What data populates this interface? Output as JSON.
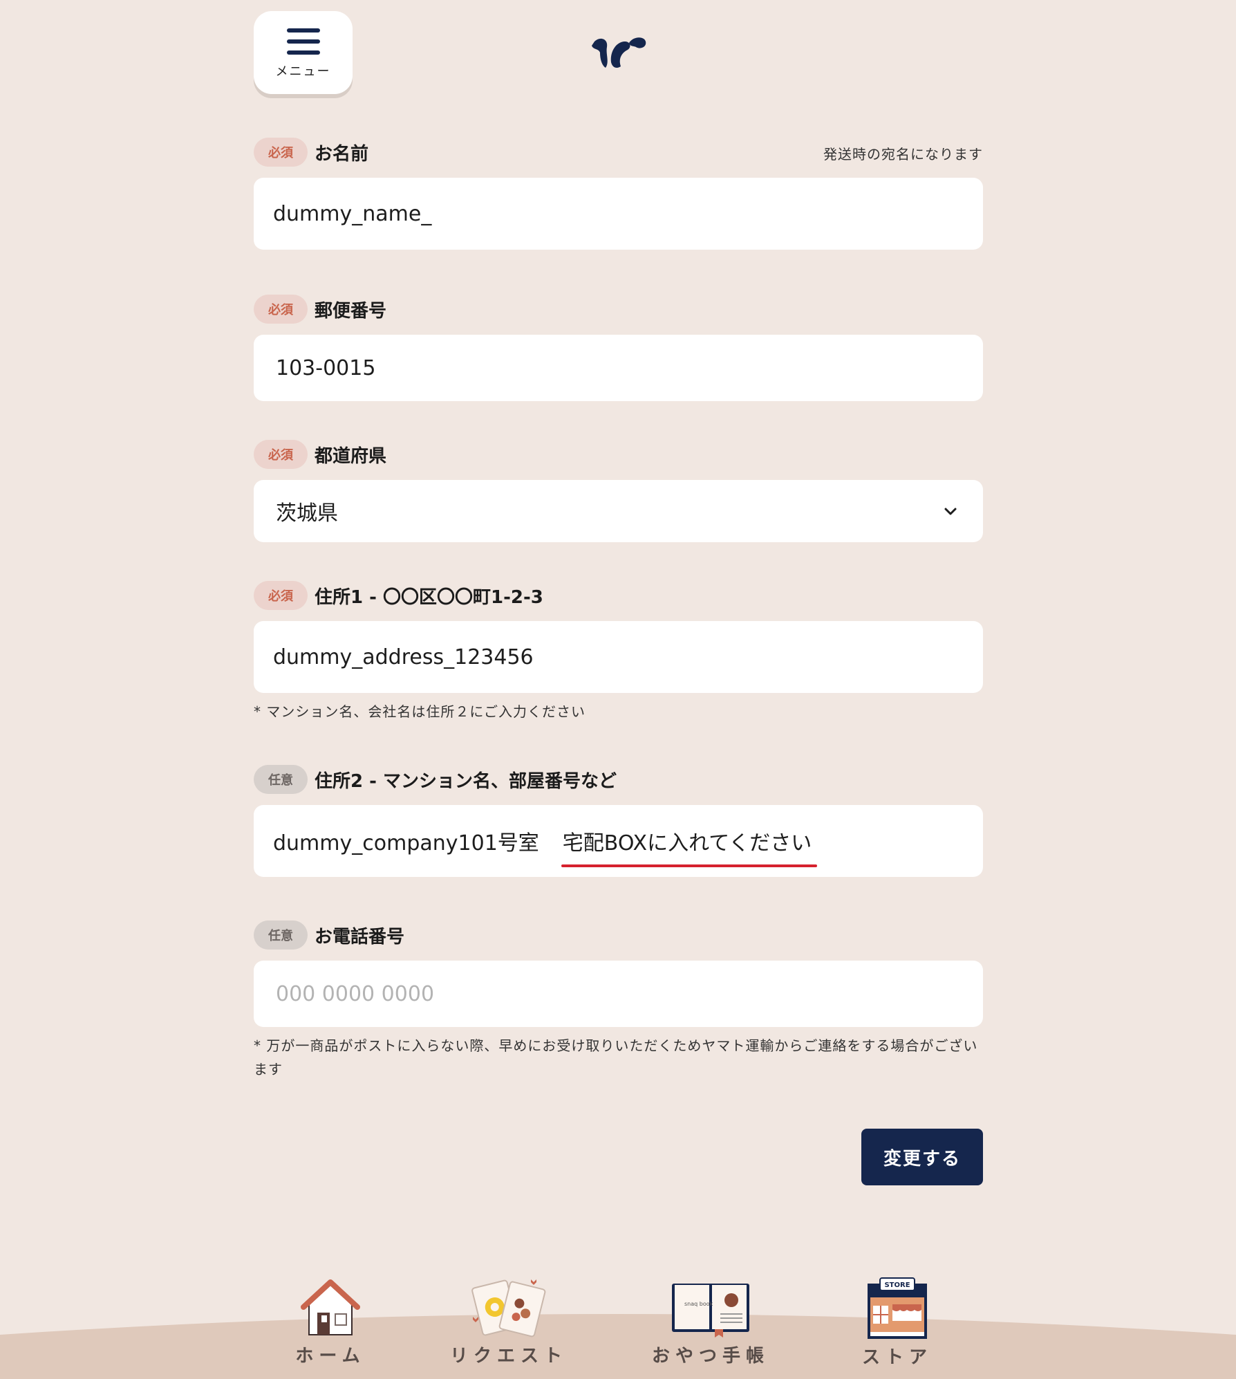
{
  "header": {
    "menu_label": "メニュー"
  },
  "form": {
    "name": {
      "badge": "必須",
      "label": "お名前",
      "hint": "発送時の宛名になります",
      "value": "dummy_name_"
    },
    "postal": {
      "badge": "必須",
      "label": "郵便番号",
      "value": "103-0015"
    },
    "prefecture": {
      "badge": "必須",
      "label": "都道府県",
      "value": "茨城県"
    },
    "address1": {
      "badge": "必須",
      "label": "住所1 - 〇〇区〇〇町1-2-3",
      "value": "dummy_address_123456",
      "note": "* マンション名、会社名は住所２にご入力ください"
    },
    "address2": {
      "badge": "任意",
      "label": "住所2 - マンション名、部屋番号など",
      "value": "dummy_company101号室",
      "value_extra": "宅配BOXに入れてください"
    },
    "phone": {
      "badge": "任意",
      "label": "お電話番号",
      "placeholder": "000 0000 0000",
      "note": "* 万が一商品がポストに入らない際、早めにお受け取りいただくためヤマト運輸からご連絡をする場合がございます"
    },
    "submit_label": "変更する"
  },
  "bottom_nav": {
    "items": [
      {
        "label": "ホーム",
        "icon": "house-icon"
      },
      {
        "label": "リクエスト",
        "icon": "snack-cards-icon"
      },
      {
        "label": "おやつ手帳",
        "icon": "snaq-book-icon"
      },
      {
        "label": "ストア",
        "icon": "store-icon"
      }
    ],
    "store_sign": "STORE",
    "book_text": "snaq book"
  },
  "colors": {
    "background": "#f1e7e1",
    "navy": "#15264d",
    "required_badge": "#ecd3cd",
    "optional_badge": "#d7d0cc",
    "underline": "#d6212e"
  }
}
